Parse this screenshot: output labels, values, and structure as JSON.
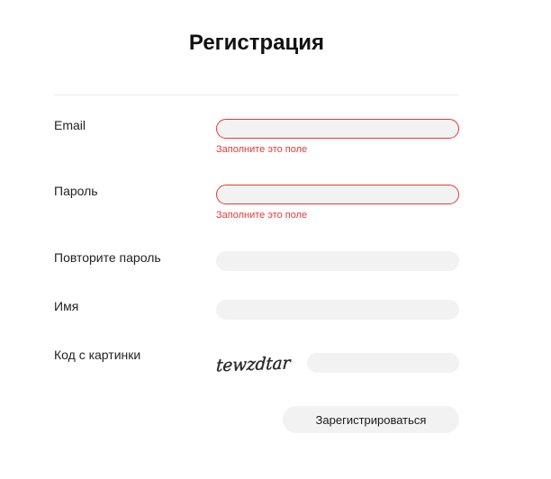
{
  "page": {
    "title": "Регистрация"
  },
  "form": {
    "email": {
      "label": "Email",
      "value": "",
      "placeholder": "",
      "error": "Заполните это поле"
    },
    "password": {
      "label": "Пароль",
      "value": "",
      "placeholder": "",
      "error": "Заполните это поле"
    },
    "password_repeat": {
      "label": "Повторите пароль",
      "value": "",
      "placeholder": ""
    },
    "name": {
      "label": "Имя",
      "value": "",
      "placeholder": ""
    },
    "captcha": {
      "label": "Код с картинки",
      "image_text": "tewzdtar",
      "value": "",
      "placeholder": ""
    },
    "submit_label": "Зарегистрироваться"
  },
  "colors": {
    "error": "#e53935",
    "field_background": "#f2f2f2",
    "divider": "#ececec"
  }
}
